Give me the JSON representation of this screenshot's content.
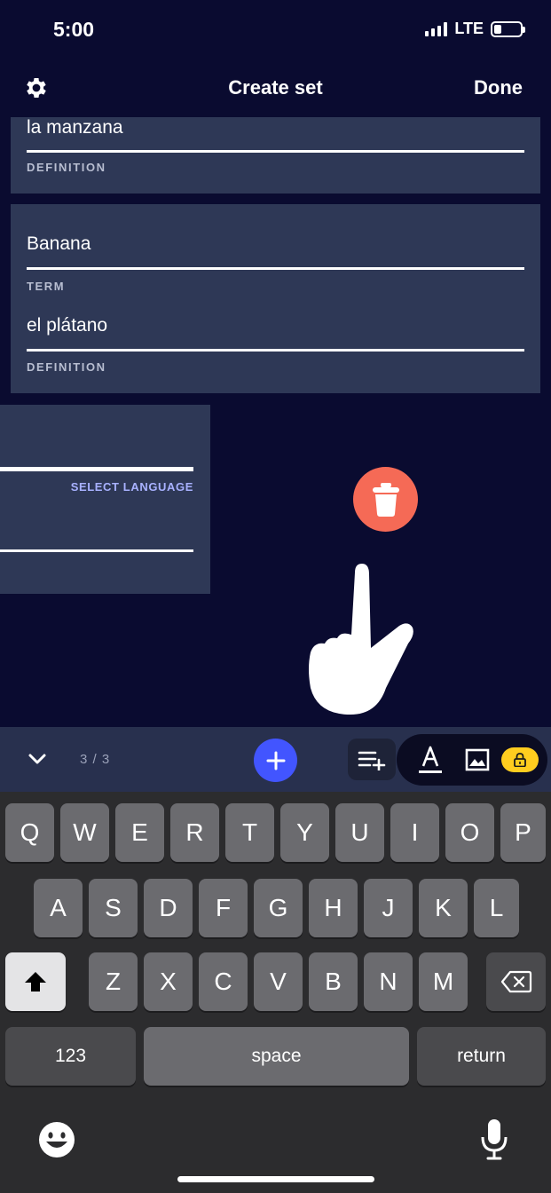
{
  "status": {
    "time": "5:00",
    "network": "LTE"
  },
  "header": {
    "title": "Create set",
    "done_label": "Done"
  },
  "cards": [
    {
      "definition": "la manzana",
      "definition_label": "DEFINITION"
    },
    {
      "term": "Banana",
      "term_label": "TERM",
      "definition": "el plátano",
      "definition_label": "DEFINITION"
    },
    {
      "select_language": "SELECT LANGUAGE"
    }
  ],
  "toolbar": {
    "counter": "3 / 3"
  },
  "keyboard": {
    "row1": [
      "Q",
      "W",
      "E",
      "R",
      "T",
      "Y",
      "U",
      "I",
      "O",
      "P"
    ],
    "row2": [
      "A",
      "S",
      "D",
      "F",
      "G",
      "H",
      "J",
      "K",
      "L"
    ],
    "row3": [
      "Z",
      "X",
      "C",
      "V",
      "B",
      "N",
      "M"
    ],
    "numbers_label": "123",
    "space_label": "space",
    "return_label": "return"
  },
  "colors": {
    "background": "#0a0b30",
    "card": "#2e3856",
    "accent_blue": "#4255ff",
    "delete_red": "#f56a56",
    "lock_yellow": "#ffcd1f",
    "select_language": "#a8b1ff"
  },
  "icons": [
    "gear-icon",
    "trash-icon",
    "pointing-hand-icon",
    "chevron-down-icon",
    "plus-icon",
    "add-list-icon",
    "text-format-icon",
    "image-icon",
    "lock-icon",
    "shift-icon",
    "backspace-icon",
    "emoji-icon",
    "microphone-icon"
  ]
}
